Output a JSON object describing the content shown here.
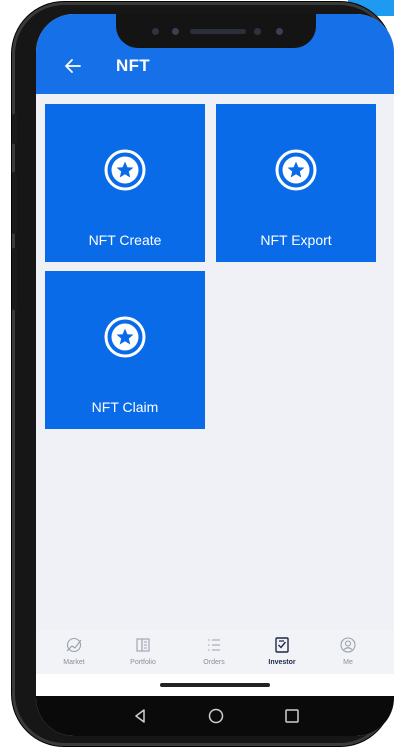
{
  "header": {
    "title": "NFT"
  },
  "tiles": [
    {
      "label": "NFT Create"
    },
    {
      "label": "NFT Export"
    },
    {
      "label": "NFT Claim"
    }
  ],
  "tabs": [
    {
      "label": "Market",
      "icon": "market-icon"
    },
    {
      "label": "Portfolio",
      "icon": "portfolio-icon"
    },
    {
      "label": "Orders",
      "icon": "orders-icon"
    },
    {
      "label": "Investor",
      "icon": "investor-icon",
      "active": true
    },
    {
      "label": "Me",
      "icon": "profile-icon"
    }
  ],
  "colors": {
    "appbar": "#1670e8",
    "tile": "#0a6be8",
    "active_tab": "#1b2a4a"
  }
}
